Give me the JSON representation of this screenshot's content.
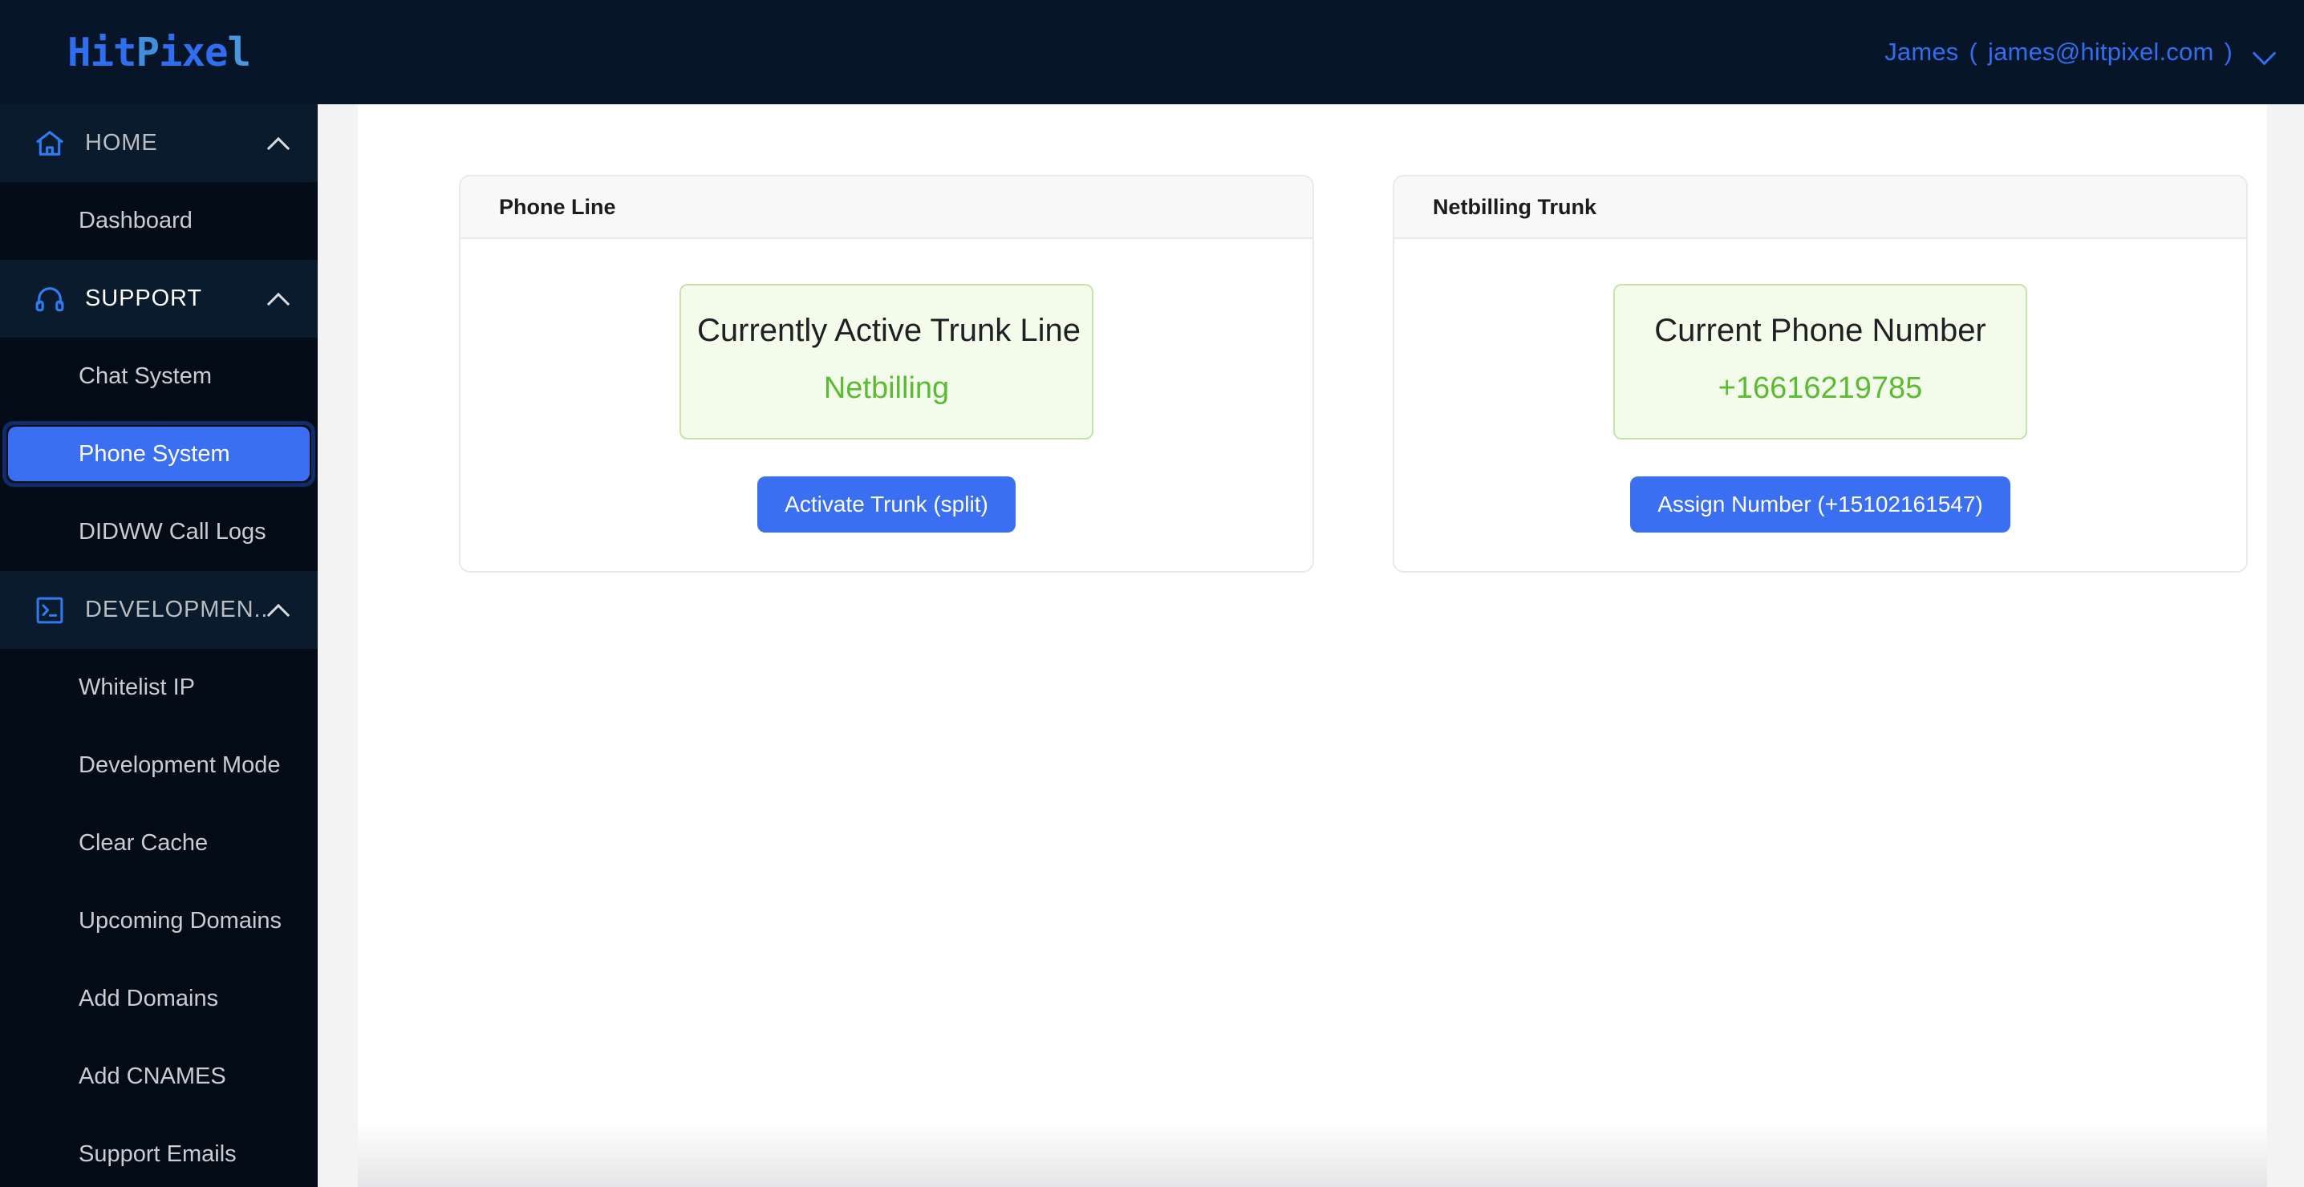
{
  "brand": {
    "logo_part1": "Hit",
    "logo_part2": "P",
    "logo_part3": "ixe",
    "logo_part4": "l",
    "logo_full": "HitPixel",
    "accent_blue": "#2f6ef0",
    "sidebar_bg": "#040d17",
    "topbar_bg": "#061628"
  },
  "topbar": {
    "user_name": "James",
    "open_paren": "(",
    "user_email": "james@hitpixel.com",
    "close_paren": ")",
    "chevron_icon": "chevron-down-icon"
  },
  "sidebar": {
    "sections": [
      {
        "label": "HOME",
        "icon": "home-icon",
        "chevron": "chevron-up-icon",
        "items": [
          {
            "label": "Dashboard",
            "active": false
          }
        ]
      },
      {
        "label": "SUPPORT",
        "icon": "headset-icon",
        "chevron": "chevron-up-icon",
        "items": [
          {
            "label": "Chat System",
            "active": false
          },
          {
            "label": "Phone System",
            "active": true
          },
          {
            "label": "DIDWW Call Logs",
            "active": false
          }
        ]
      },
      {
        "label": "DEVELOPMEN...",
        "icon": "terminal-icon",
        "chevron": "chevron-up-icon",
        "items": [
          {
            "label": "Whitelist IP",
            "active": false
          },
          {
            "label": "Development Mode",
            "active": false
          },
          {
            "label": "Clear Cache",
            "active": false
          },
          {
            "label": "Upcoming Domains",
            "active": false
          },
          {
            "label": "Add Domains",
            "active": false
          },
          {
            "label": "Add CNAMES",
            "active": false
          },
          {
            "label": "Support Emails",
            "active": false
          }
        ]
      }
    ]
  },
  "main": {
    "cards": [
      {
        "title": "Phone Line",
        "alert_title": "Currently Active Trunk Line",
        "alert_value": "Netbilling",
        "button_label": "Activate Trunk (split)",
        "alert_border_color": "#c4e4a9",
        "alert_bg_color": "#f3fbeb",
        "alert_value_color": "#5bbb33",
        "button_color": "#3b6ff2"
      },
      {
        "title": "Netbilling Trunk",
        "alert_title": "Current Phone Number",
        "alert_value": "+16616219785",
        "button_label": "Assign Number (+15102161547)",
        "alert_border_color": "#c4e4a9",
        "alert_bg_color": "#f3fbeb",
        "alert_value_color": "#5bbb33",
        "button_color": "#3b6ff2"
      }
    ]
  }
}
